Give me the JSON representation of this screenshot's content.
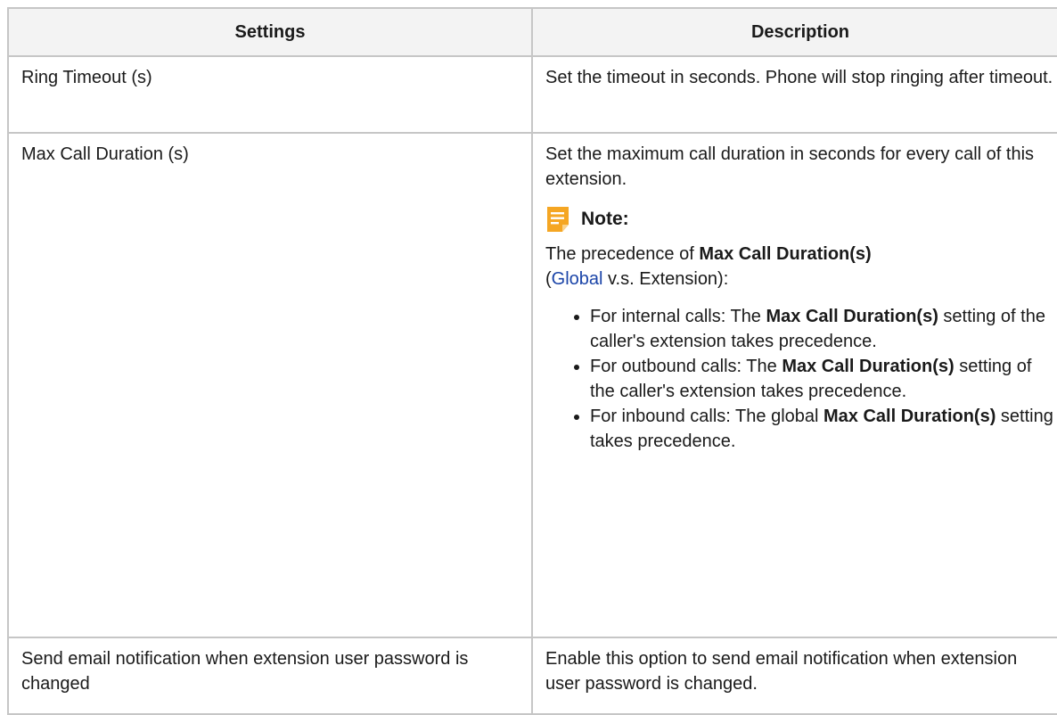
{
  "table": {
    "headers": {
      "settings": "Settings",
      "description": "Description"
    },
    "rows": [
      {
        "setting": "Ring Timeout (s)",
        "description": "Set the timeout in seconds. Phone will stop ringing after timeout."
      },
      {
        "setting": "Max Call Duration (s)",
        "description": "Set the maximum call duration in seconds for every call of this extension.",
        "note": {
          "title": "Note:",
          "intro_prefix": "The precedence of ",
          "intro_bold": "Max Call Duration(s)",
          "intro_paren_open": "(",
          "intro_link": "Global",
          "intro_suffix": " v.s. Extension):",
          "items": [
            {
              "prefix": "For internal calls: The ",
              "bold": "Max Call Duration(s)",
              "suffix": " setting of the caller's extension takes precedence."
            },
            {
              "prefix": "For outbound calls: The ",
              "bold": "Max Call Duration(s)",
              "suffix": " setting of the caller's extension takes precedence."
            },
            {
              "prefix": "For inbound calls: The global ",
              "bold": "Max Call Duration(s)",
              "suffix": " setting takes precedence."
            }
          ]
        }
      },
      {
        "setting": "Send email notification when extension user password is changed",
        "description": "Enable this option to send email notification when extension user password is changed."
      }
    ]
  },
  "icons": {
    "note": "note-icon"
  },
  "colors": {
    "note_icon": "#f5a623",
    "link": "#1a44a8",
    "header_bg": "#f3f3f3",
    "border": "#c6c6c6"
  }
}
